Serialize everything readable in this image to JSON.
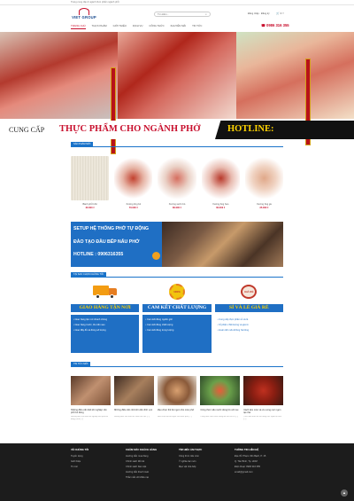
{
  "topbar": {
    "text": "Trang cung cấp & ngành thực phẩm ngành phở"
  },
  "header": {
    "logo_text": "VIET GROUP",
    "search_placeholder": "Tìm kiếm...",
    "account": "Đăng nhập · Đăng ký",
    "cart": "0 ₫"
  },
  "nav": {
    "items": [
      "TRANG CHỦ",
      "THỰC PHẨM",
      "GIỚI THIỆU",
      "DỊCH VỤ",
      "CÔNG THỨC",
      "KHUYẾN MÃI",
      "TIN TỨC"
    ],
    "phone": "0986 316 355"
  },
  "headline": {
    "cung_cap": "CUNG CẤP",
    "thuc_pham": "THỰC PHẨM CHO NGÀNH PHỞ",
    "hotline": "HOTLINE:"
  },
  "products_section": {
    "title": "SẢN PHẨM MỚI",
    "items": [
      {
        "name": "Bánh phở khô",
        "price": "30.000 ₫"
      },
      {
        "name": "Xương ống bò",
        "price": "70.000 ₫"
      },
      {
        "name": "Xương sườn bò",
        "price": "80.000 ₫"
      },
      {
        "name": "Xương ống heo",
        "price": "60.000 ₫"
      },
      {
        "name": "Xương ống gà",
        "price": "35.000 ₫"
      }
    ]
  },
  "setup": {
    "line1": "SETUP HỆ THỐNG PHỞ TỰ ĐỘNG",
    "line2": "ĐÀO TẠO ĐẦU BẾP NẤU PHỞ",
    "line3": "HOTLINE : 0906316355"
  },
  "why_section": {
    "title": "TẠI SAO CHỌN CHÚNG TÔI",
    "badge_text": "100%",
    "stamp_text": "GIÁ RẺ",
    "columns": [
      {
        "title": "GIAO HÀNG TẬN NƠI",
        "items": [
          "Giao hàng tận nơi nhanh chóng",
          "Giao hàng trước, thu tiền sau",
          "Giao đầy đủ và đúng số lượng"
        ]
      },
      {
        "title": "CAM KẾT CHẤT LƯỢNG",
        "items": [
          "Cam kết đúng nguồn gốc",
          "Cam kết đúng chất lượng",
          "Cam kết đúng trọng lượng"
        ]
      },
      {
        "title": "SỈ VÀ LẺ GIÁ RẺ",
        "items": [
          "Cung cấp thực phẩm sỉ và lẻ",
          "Sỉ phẩm chất lượng và giá rẻ",
          "Hoàn tiền nếu không hài lòng"
        ]
      }
    ]
  },
  "news_section": {
    "title": "TIN TỨC MỚI",
    "items": [
      {
        "title": "Những điều cần biết khi nghiệp vốn phở bò đúng",
        "desc": "Những điều cần biết khi nghiệp vốn phở bò đúng cách [...]"
      },
      {
        "title": "Những điều cần nhớ khi cầm lĩnh vực",
        "desc": "Những điều cần nhớ khi cầm lĩnh vực [...]"
      },
      {
        "title": "Mẹo chọn thịt bò ngon cho món phở",
        "desc": "Mẹo chọn thịt bò ngon cho món phở [...]"
      },
      {
        "title": "Công thức nấu nước dùng bò với rau",
        "desc": "Công thức nấu nước dùng bò với rau củ [...]"
      },
      {
        "title": "Cách làm món xá xíu xong cực ngon tại nhà",
        "desc": "Cách làm món xá xíu xong cực ngon tại nhà [...]"
      }
    ]
  },
  "footer": {
    "col1": {
      "title": "VỀ CHÚNG TÔI",
      "links": [
        "Tuyển dụng",
        "Giới thiệu",
        "Tin tức"
      ]
    },
    "col2": {
      "title": "CHĂM SÓC KHÁCH HÀNG",
      "links": [
        "Hướng dẫn mua hàng",
        "Chính sách đổi trả",
        "Chính sách bảo mật",
        "Hướng dẫn thanh toán",
        "Thắc mắc về khiếu nại"
      ]
    },
    "col3": {
      "title": "TÌM HIỂU ẨM THỰC",
      "links": [
        "Công thức nấu món",
        "Ý nghĩa các món",
        "Mẹo vặt nhà bếp"
      ]
    },
    "col4": {
      "title": "THÔNG TIN LIÊN HỆ",
      "lines": [
        "Địa chỉ: Phạm Văn Bạch, P. 15",
        "Q. Tân Bình, Tp. HCM",
        "Điện thoại: 0906 316 355",
        "email@gmail.com"
      ]
    }
  },
  "totop": "▲"
}
